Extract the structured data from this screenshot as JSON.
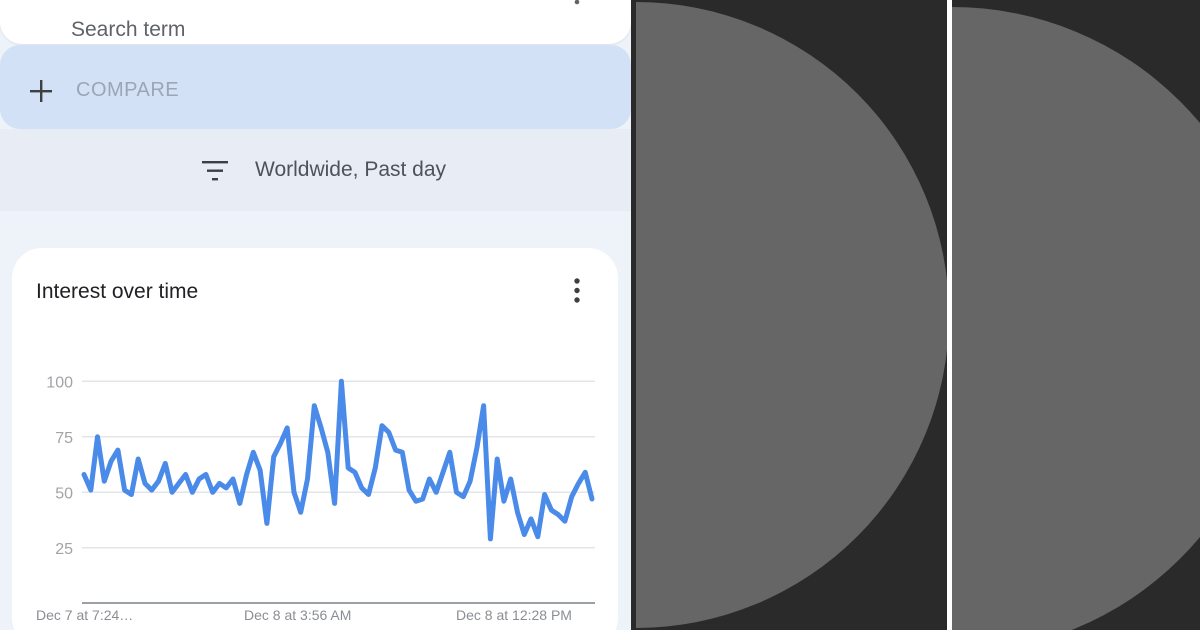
{
  "search": {
    "placeholder": "Search term"
  },
  "compare": {
    "label": "COMPARE"
  },
  "filter": {
    "label": "Worldwide, Past day"
  },
  "card": {
    "title": "Interest over time"
  },
  "colors": {
    "line": "#4a8ae8",
    "accent": "#d2e1f5",
    "panel_dark": "#2a2a2a",
    "panel_circle": "#666666"
  },
  "chart_data": {
    "type": "line",
    "title": "Interest over time",
    "y_ticks": [
      "100",
      "75",
      "50",
      "25"
    ],
    "ylim": [
      0,
      100
    ],
    "x_tick_labels": [
      "Dec 7 at 7:24…",
      "Dec 8 at 3:56 AM",
      "Dec 8 at 12:28 PM"
    ],
    "grid": true,
    "series": [
      {
        "values": [
          58,
          51,
          75,
          55,
          64,
          69,
          51,
          49,
          65,
          54,
          51,
          55,
          63,
          50,
          54,
          58,
          50,
          56,
          58,
          50,
          54,
          52,
          56,
          45,
          58,
          68,
          60,
          36,
          66,
          72,
          79,
          50,
          41,
          56,
          89,
          79,
          68,
          45,
          100,
          61,
          59,
          52,
          49,
          61,
          80,
          77,
          69,
          68,
          51,
          46,
          47,
          56,
          50,
          59,
          68,
          50,
          48,
          55,
          70,
          89,
          29,
          65,
          46,
          56,
          41,
          31,
          38,
          30,
          49,
          42,
          40,
          37,
          48,
          54,
          59,
          47
        ]
      }
    ]
  }
}
